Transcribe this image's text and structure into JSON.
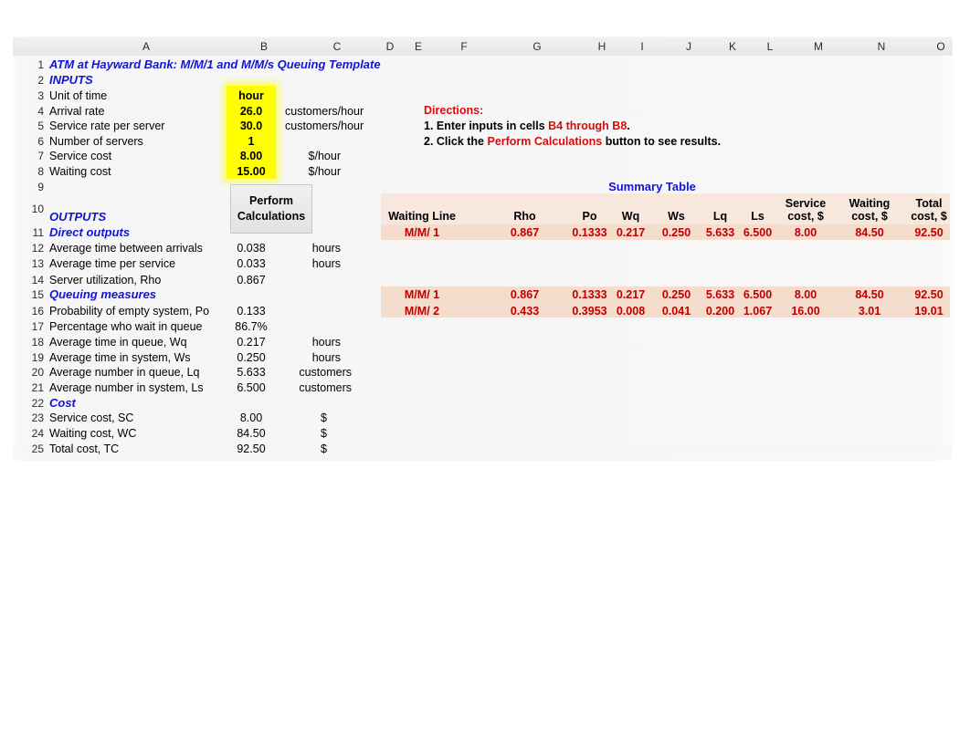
{
  "spreadsheet": {
    "column_letters": [
      "A",
      "B",
      "C",
      "D",
      "E",
      "F",
      "G",
      "H",
      "I",
      "J",
      "K",
      "L",
      "M",
      "N",
      "O"
    ],
    "row_numbers": [
      "1",
      "2",
      "3",
      "4",
      "5",
      "6",
      "7",
      "8",
      "9",
      "10",
      "11",
      "12",
      "13",
      "14",
      "15",
      "16",
      "17",
      "18",
      "19",
      "20",
      "21",
      "22",
      "23",
      "24",
      "25"
    ],
    "title": "ATM at Hayward Bank: M/M/1 and M/M/s Queuing Template",
    "inputs_header": "INPUTS",
    "inputs": [
      {
        "label": "Unit of time",
        "value": "hour",
        "unit": ""
      },
      {
        "label": "Arrival rate",
        "value": "26.0",
        "unit": "customers/hour"
      },
      {
        "label": "Service rate per server",
        "value": "30.0",
        "unit": "customers/hour"
      },
      {
        "label": "Number of servers",
        "value": "1",
        "unit": ""
      },
      {
        "label": "Service cost",
        "value": "8.00",
        "unit": "$/hour"
      },
      {
        "label": "Waiting cost",
        "value": "15.00",
        "unit": "$/hour"
      }
    ],
    "calc_button_label": "Perform Calculations",
    "outputs_header": "OUTPUTS",
    "direct_outputs_header": "Direct outputs",
    "direct_outputs": [
      {
        "label": "Average time between arrivals",
        "value": "0.038",
        "unit": "hours"
      },
      {
        "label": "Average time per service",
        "value": "0.033",
        "unit": "hours"
      },
      {
        "label": "Server utilization, Rho",
        "value": "0.867",
        "unit": ""
      }
    ],
    "queuing_measures_header": "Queuing measures",
    "queuing_measures": [
      {
        "label": "Probability of empty system, Po",
        "value": "0.133",
        "unit": ""
      },
      {
        "label": "Percentage who wait in queue",
        "value": "86.7%",
        "unit": ""
      },
      {
        "label": "Average time in queue, Wq",
        "value": "0.217",
        "unit": "hours"
      },
      {
        "label": "Average time in system, Ws",
        "value": "0.250",
        "unit": "hours"
      },
      {
        "label": "Average number in queue, Lq",
        "value": "5.633",
        "unit": "customers"
      },
      {
        "label": "Average number in system, Ls",
        "value": "6.500",
        "unit": "customers"
      }
    ],
    "cost_header": "Cost",
    "costs": [
      {
        "label": "Service cost, SC",
        "value": "8.00",
        "unit": "$"
      },
      {
        "label": "Waiting cost, WC",
        "value": "84.50",
        "unit": "$"
      },
      {
        "label": "Total cost, TC",
        "value": "92.50",
        "unit": "$"
      }
    ]
  },
  "directions": {
    "title": "Directions:",
    "step1_prefix": "1.  Enter inputs in cells ",
    "step1_ref": "B4 through B8",
    "step1_suffix": ".",
    "step2_prefix": "2.  Click the ",
    "step2_ref": "Perform Calculations",
    "step2_suffix": " button to see results."
  },
  "summary_table": {
    "title": "Summary Table",
    "columns": [
      "Waiting Line",
      "Rho",
      "Po",
      "Wq",
      "Ws",
      "Lq",
      "Ls",
      "Service cost, $",
      "Waiting cost, $",
      "Total cost, $"
    ],
    "columns_wrapped": [
      {
        "line1": "Waiting Line",
        "line2": ""
      },
      {
        "line1": "Rho",
        "line2": ""
      },
      {
        "line1": "Po",
        "line2": ""
      },
      {
        "line1": "Wq",
        "line2": ""
      },
      {
        "line1": "Ws",
        "line2": ""
      },
      {
        "line1": "Lq",
        "line2": ""
      },
      {
        "line1": "Ls",
        "line2": ""
      },
      {
        "line1": "Service",
        "line2": "cost, $"
      },
      {
        "line1": "Waiting",
        "line2": "cost, $"
      },
      {
        "line1": "Total",
        "line2": "cost, $"
      }
    ],
    "current_row": {
      "name": "M/M/ 1",
      "rho": "0.867",
      "po": "0.1333",
      "wq": "0.217",
      "ws": "0.250",
      "lq": "5.633",
      "ls": "6.500",
      "service_cost": "8.00",
      "waiting_cost": "84.50",
      "total_cost": "92.50"
    },
    "comparison_rows": [
      {
        "name": "M/M/ 1",
        "rho": "0.867",
        "po": "0.1333",
        "wq": "0.217",
        "ws": "0.250",
        "lq": "5.633",
        "ls": "6.500",
        "service_cost": "8.00",
        "waiting_cost": "84.50",
        "total_cost": "92.50"
      },
      {
        "name": "M/M/ 2",
        "rho": "0.433",
        "po": "0.3953",
        "wq": "0.008",
        "ws": "0.041",
        "lq": "0.200",
        "ls": "1.067",
        "service_cost": "16.00",
        "waiting_cost": "3.01",
        "total_cost": "19.01"
      }
    ]
  },
  "colors": {
    "title_blue": "#1414d2",
    "directions_red": "#dd0a0a",
    "data_red": "#c00000",
    "input_highlight": "#ffff00",
    "table_shade": "#f4ddcd"
  }
}
